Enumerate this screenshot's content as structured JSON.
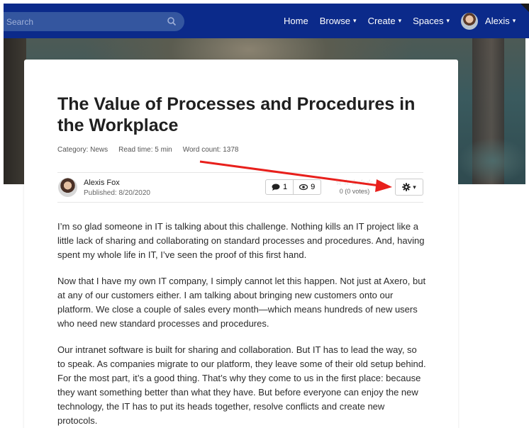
{
  "nav": {
    "search_placeholder": "Search",
    "home": "Home",
    "browse": "Browse",
    "create": "Create",
    "spaces": "Spaces",
    "user": "Alexis",
    "caret": "▾",
    "bar_color": "#0b2a8a"
  },
  "article": {
    "title": "The Value of Processes and Procedures in the Workplace",
    "category": "Category: News",
    "read_time": "Read time: 5 min",
    "word_count": "Word count: 1378",
    "author": "Alexis Fox",
    "published": "Published: 8/20/2020",
    "comments": "1",
    "views": "9",
    "stars": "☆☆☆☆☆",
    "votes": "0 (0 votes)",
    "paragraphs": [
      "I’m so glad someone in IT is talking about this challenge. Nothing kills an IT project like a little lack of sharing and collaborating on standard processes and procedures. And, having spent my whole life in IT, I’ve seen the proof of this first hand.",
      "Now that I have my own IT company, I simply cannot let this happen. Not just at Axero, but at any of our customers either. I am talking about bringing new customers onto our platform. We close a couple of sales every month—which means hundreds of new users who need new standard processes and procedures.",
      "Our intranet software is built for sharing and collaboration. But IT has to lead the way, so to speak. As companies migrate to our platform, they leave some of their old setup behind. For the most part, it’s a good thing. That’s why they come to us in the first place: because they want something better than what they have. But before everyone can enjoy the new technology, the IT has to put its heads together, resolve conflicts and create new protocols."
    ]
  },
  "annotation": {
    "arrow_color": "#e8201c"
  }
}
